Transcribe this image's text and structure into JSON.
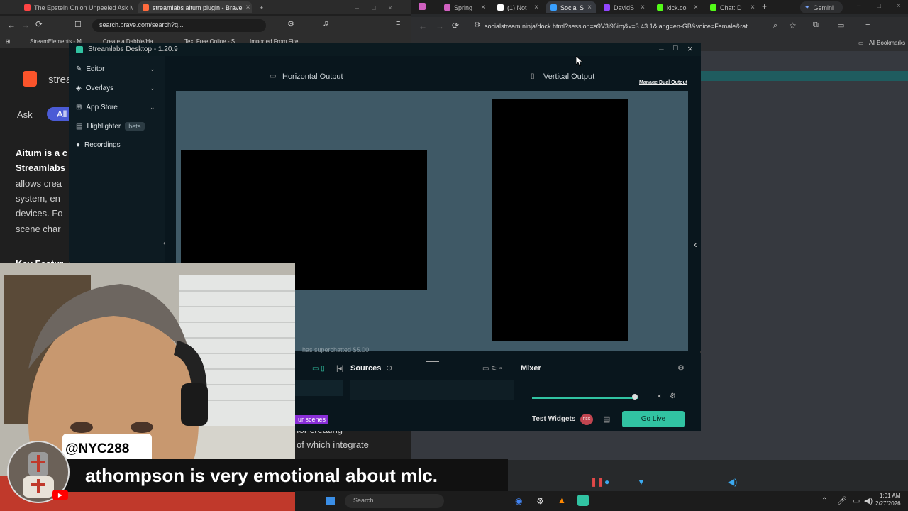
{
  "left_browser": {
    "tabs": [
      {
        "label": "The Epstein Onion Unpeeled Ask Me",
        "color": "#ff4444"
      },
      {
        "label": "streamlabs aitum plugin - Brave",
        "color": "#ff6b3d"
      }
    ],
    "new_tab": "+",
    "url": "search.brave.com/search?q...",
    "bookmarks": [
      "StreamElements - M",
      "Create a Dabble/Ha",
      "Text Free Online - S",
      "Imported From Fire"
    ],
    "page": {
      "brand": "strea",
      "ask": "Ask",
      "all": "All",
      "lines": [
        "Aitum is a c",
        "Streamlabs",
        "allows crea",
        "system, en",
        "devices. Fo",
        "scene char"
      ],
      "key_features": "Key Featur",
      "bottom_lines": [
        "for creating",
        "of which integrate"
      ]
    }
  },
  "right_browser": {
    "tabs": [
      {
        "label": "Spring",
        "color": "#d060c0"
      },
      {
        "label": "(1) Not",
        "color": "#ffffff"
      },
      {
        "label": "Social S",
        "color": "#39a0ff"
      },
      {
        "label": "DavidS",
        "color": "#9146ff"
      },
      {
        "label": "kick.co",
        "color": "#53fc18"
      },
      {
        "label": "Chat: D",
        "color": "#53fc18"
      }
    ],
    "gemini": "Gemini",
    "url": "socialstream.ninja/dock.html?session=a9V3i96irq&v=3.43.1&lang=en-GB&voice=Female&rat...",
    "bookmarks_right": "All Bookmarks"
  },
  "streamlabs": {
    "title": "Streamlabs Desktop - 1.20.9",
    "nav": [
      {
        "label": "Editor",
        "icon": "edit-icon",
        "chevron": true
      },
      {
        "label": "Overlays",
        "icon": "overlays-icon",
        "chevron": true
      },
      {
        "label": "App Store",
        "icon": "store-icon",
        "chevron": true
      },
      {
        "label": "Highlighter",
        "icon": "highlighter-icon",
        "chevron": false
      },
      {
        "label": "Recordings",
        "icon": "recordings-icon",
        "chevron": false
      }
    ],
    "beta": "beta",
    "horizontal_output": "Horizontal Output",
    "vertical_output": "Vertical Output",
    "manage_dual_output": "Manage Dual Output",
    "overlay_text": "has supercha­tted $5.00",
    "sources": "Sources",
    "mixer": "Mixer",
    "scenes_badge": "ur scenes",
    "test_widgets": "Test Widgets",
    "go_live": "Go Live",
    "rec_label": "REC"
  },
  "caption": {
    "handle": "@NYC288",
    "message": "athompson is very emotional about mlc."
  },
  "taskbar": {
    "search": "Search",
    "time": "1:01 AM",
    "date": "2/27/2026"
  }
}
